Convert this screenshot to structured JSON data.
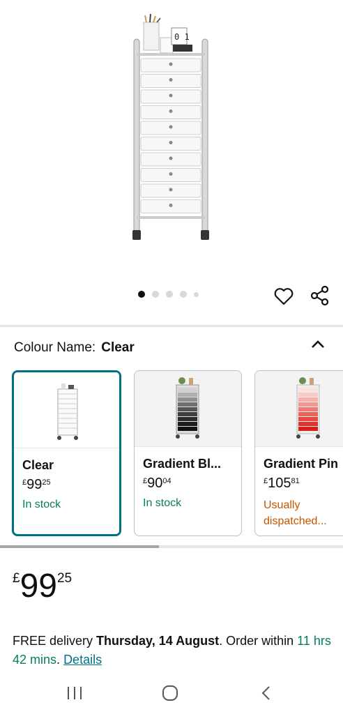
{
  "gallery": {
    "dots": 5,
    "active": 0
  },
  "variation": {
    "label": "Colour Name:",
    "selected": "Clear"
  },
  "swatches": [
    {
      "name": "Clear",
      "currency": "£",
      "whole": "99",
      "fraction": "25",
      "availability": "In stock",
      "availability_color": "#067d62"
    },
    {
      "name": "Gradient Bl...",
      "currency": "£",
      "whole": "90",
      "fraction": "04",
      "availability": "In stock",
      "availability_color": "#067d62"
    },
    {
      "name": "Gradient Pin",
      "currency": "£",
      "whole": "105",
      "fraction": "81",
      "availability": "Usually dispatched...",
      "availability_color": "#c45500"
    }
  ],
  "price": {
    "currency": "£",
    "whole": "99",
    "fraction": "25"
  },
  "delivery": {
    "prefix": "FREE delivery",
    "date": "Thursday, 14 August",
    "order_within": ". Order within",
    "time": "11 hrs 42 mins",
    "sep": ".",
    "details_link": "Details"
  },
  "colors": {
    "accent": "#007185",
    "in_stock": "#067d62",
    "dispatch": "#c45500"
  }
}
